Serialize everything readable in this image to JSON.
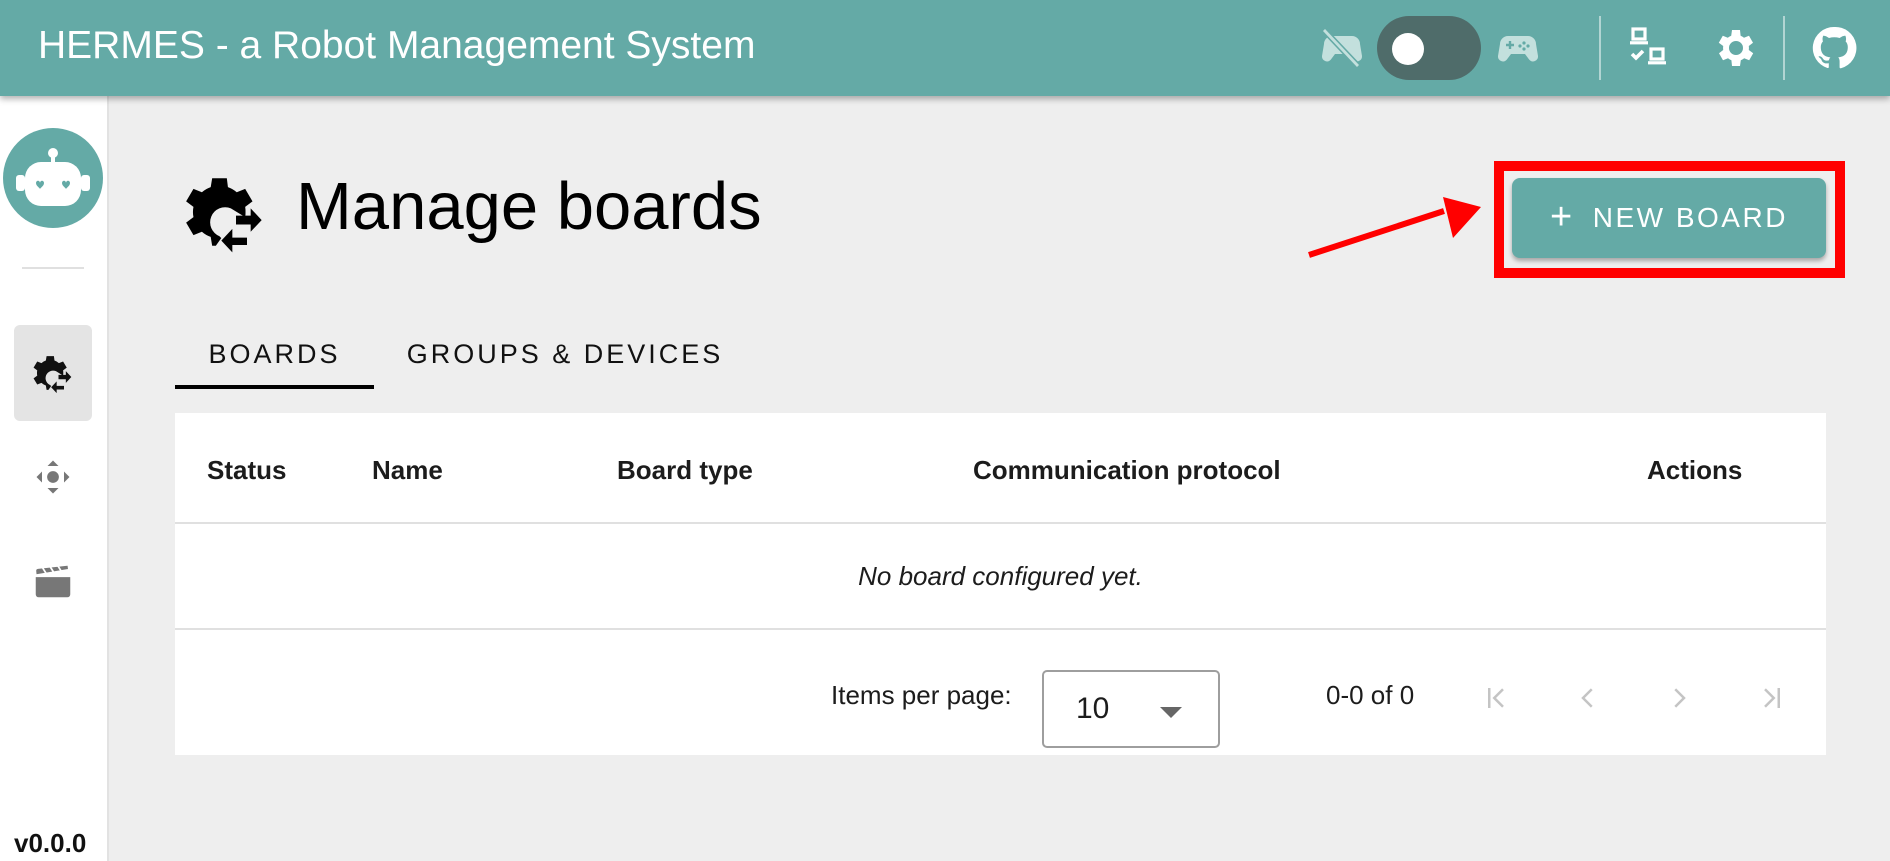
{
  "header": {
    "title": "HERMES - a Robot Management System",
    "icons": {
      "gamepad_off": "gamepad-off-icon",
      "mode_toggle": "toggle-switch",
      "gamepad": "gamepad-icon",
      "devices": "devices-check-icon",
      "settings": "gear-icon",
      "github": "github-icon"
    },
    "toggle_on": false
  },
  "sidebar": {
    "logo": "robot-logo",
    "items": [
      {
        "name": "boards",
        "icon": "gear-swap-icon",
        "active": true
      },
      {
        "name": "controls",
        "icon": "move-control-icon",
        "active": false
      },
      {
        "name": "animations",
        "icon": "clapperboard-icon",
        "active": false
      }
    ],
    "version": "v0.0.0"
  },
  "page": {
    "title": "Manage boards",
    "new_board_label": "NEW BOARD",
    "new_board_plus": "+"
  },
  "tabs": [
    {
      "label": "BOARDS",
      "active": true
    },
    {
      "label": "GROUPS & DEVICES",
      "active": false
    }
  ],
  "table": {
    "columns": [
      "Status",
      "Name",
      "Board type",
      "Communication protocol",
      "Actions"
    ],
    "empty_message": "No board configured yet.",
    "paginator": {
      "items_per_page_label": "Items per page:",
      "items_per_page": "10",
      "range": "0-0 of 0"
    }
  },
  "annotation": {
    "color": "#ff0000",
    "target": "new-board-button"
  },
  "colors": {
    "accent": "#64aaa6",
    "toggle_track": "#4f6c6a",
    "background": "#eeeeee"
  }
}
